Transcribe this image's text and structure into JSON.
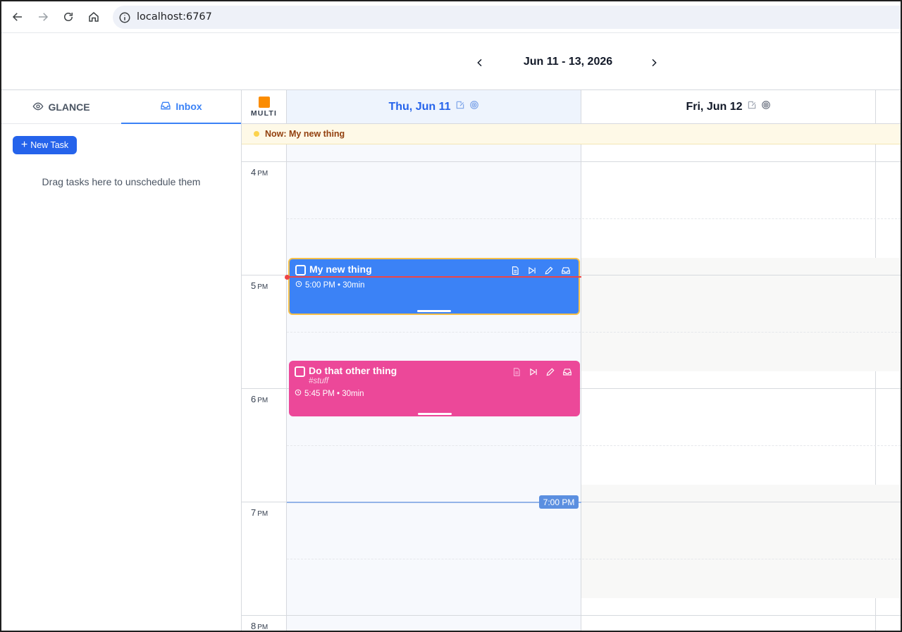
{
  "browser": {
    "url": "localhost:6767",
    "icons": [
      "back-arrow-icon",
      "forward-arrow-icon",
      "reload-icon",
      "home-icon",
      "info-icon"
    ]
  },
  "header": {
    "date_range": "Jun 11 - 13, 2026"
  },
  "sidebar": {
    "tabs": [
      {
        "label": "GLANCE",
        "icon": "eye-icon",
        "active": false
      },
      {
        "label": "Inbox",
        "icon": "inbox-icon",
        "active": true
      }
    ],
    "new_task_label": "New Task",
    "drag_hint": "Drag tasks here to unschedule them"
  },
  "calendar": {
    "multi_label": "MULTI",
    "days": [
      {
        "label": "Thu, Jun 11",
        "today": true
      },
      {
        "label": "Fri, Jun 12",
        "today": false
      }
    ],
    "now_banner": "Now: My new thing",
    "hours": [
      {
        "num": "4",
        "suffix": "PM"
      },
      {
        "num": "5",
        "suffix": "PM"
      },
      {
        "num": "6",
        "suffix": "PM"
      },
      {
        "num": "7",
        "suffix": "PM"
      },
      {
        "num": "8",
        "suffix": "PM"
      }
    ],
    "cursor_time": "7:00 PM",
    "events": [
      {
        "title": "My new thing",
        "tag": "",
        "time": "5:00 PM • 30min",
        "color": "#3b82f6"
      },
      {
        "title": "Do that other thing",
        "tag": "#stuff",
        "time": "5:45 PM • 30min",
        "color": "#ec4899"
      }
    ]
  },
  "colors": {
    "accent": "#2563eb",
    "today_bg": "#eef4fd",
    "now_indicator": "#ef4444",
    "multi_square": "#fb8c00"
  }
}
